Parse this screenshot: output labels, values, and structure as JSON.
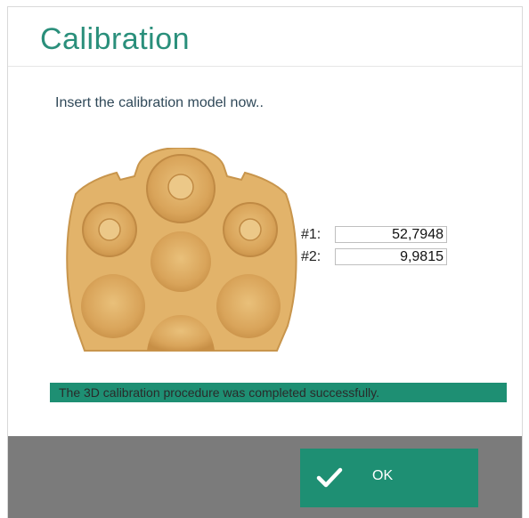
{
  "dialog": {
    "title": "Calibration",
    "instruction": "Insert the calibration model now..",
    "fields": [
      {
        "label": "#1:",
        "value": "52,7948"
      },
      {
        "label": "#2:",
        "value": "9,9815"
      }
    ],
    "status_message": "The 3D calibration procedure was completed successfully.",
    "ok_label": "OK"
  },
  "colors": {
    "accent": "#1e8f73",
    "title": "#2a8f7b",
    "footer": "#7b7b7b",
    "model": "#e2b36a"
  },
  "icons": {
    "ok": "checkmark-icon"
  }
}
